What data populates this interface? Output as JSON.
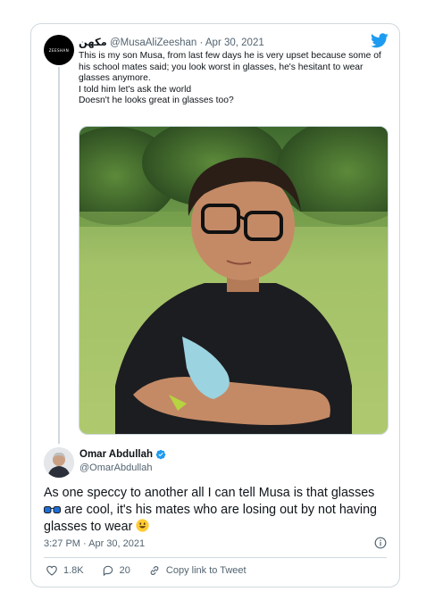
{
  "quoted_tweet": {
    "display_name": "مکھن",
    "avatar_text": "ZEESHAN",
    "handle": "@MusaAliZeeshan",
    "separator": " · ",
    "date": "Apr 30, 2021",
    "text_lines": [
      "This is my son Musa, from last few days he is very upset because some of his school mates said; you look worst in glasses, he's hesitant to wear glasses anymore.",
      "I told him let's ask the world",
      "Doesn't he looks great in glasses too?"
    ],
    "image_icon": "photo-of-boy-wearing-glasses"
  },
  "reply_tweet": {
    "display_name": "Omar Abdullah",
    "handle": "@OmarAbdullah",
    "verified_icon": "verified-badge-icon",
    "text_part1": "As one speccy to another all I can tell Musa is that glasses ",
    "emoji_glasses": "glasses-emoji",
    "text_part2": " are cool, it's his mates who are losing out by not having glasses to wear ",
    "emoji_smile": "smiley-emoji",
    "timestamp": "3:27 PM · Apr 30, 2021"
  },
  "actions": {
    "likes": "1.8K",
    "replies": "20",
    "copy_link": "Copy link to Tweet"
  },
  "colors": {
    "twitter_blue": "#1d9bf0",
    "secondary_text": "#536471",
    "border": "#cfd9de"
  }
}
